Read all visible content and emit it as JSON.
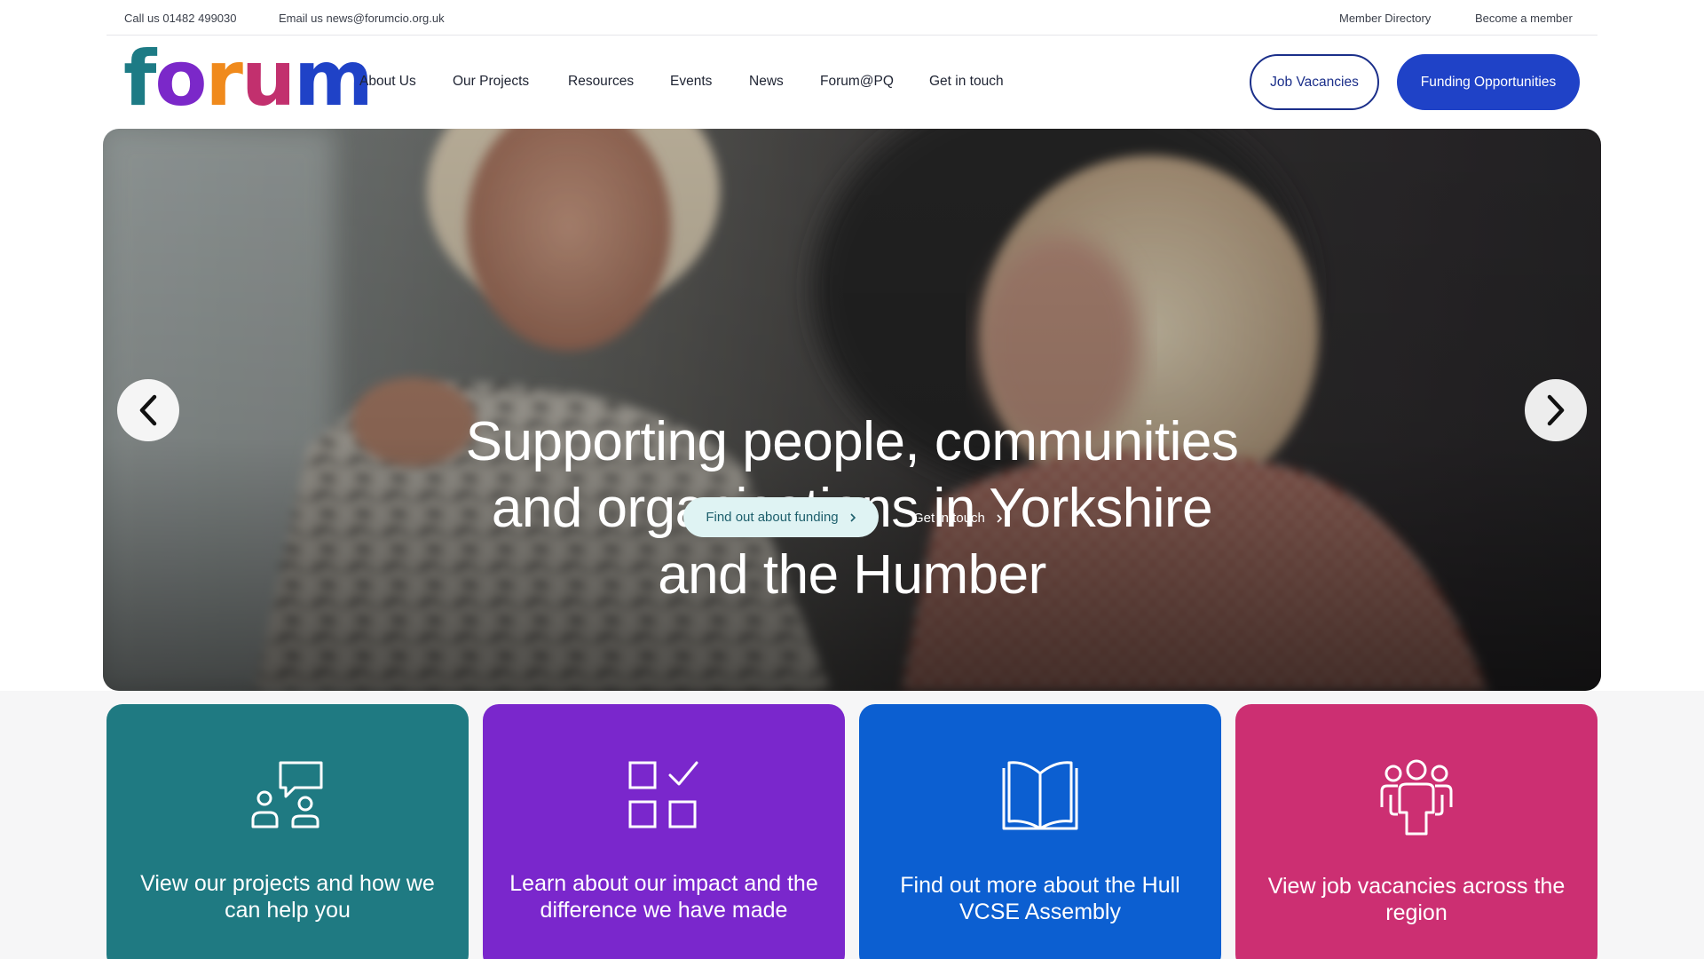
{
  "topbar": {
    "phone": "Call us 01482 499030",
    "email": "Email us news@forumcio.org.uk",
    "member_directory": "Member Directory",
    "become_member": "Become a member"
  },
  "logo": {
    "letters": [
      "f",
      "o",
      "r",
      "u",
      "m"
    ],
    "colors": [
      "#1d7b85",
      "#7b28c9",
      "#f08a1c",
      "#c2306e",
      "#1f42c7"
    ]
  },
  "nav": {
    "items": [
      "About Us",
      "Our Projects",
      "Resources",
      "Events",
      "News",
      "Forum@PQ",
      "Get in touch"
    ]
  },
  "header_buttons": {
    "job_vacancies": "Job Vacancies",
    "funding": "Funding Opportunities"
  },
  "hero": {
    "title_lines": [
      "Supporting people, communities",
      "and organisations in Yorkshire",
      "and the Humber"
    ],
    "primary_cta": "Find out about funding",
    "secondary_cta": "Get in touch",
    "prev_icon": "chevron-left-icon",
    "next_icon": "chevron-right-icon"
  },
  "cards": [
    {
      "text": "View our projects and how we can help you",
      "color": "#1f7a82",
      "icon": "people-chat-icon"
    },
    {
      "text": "Learn about our impact and the difference we have made",
      "color": "#7a27cc",
      "icon": "checklist-grid-icon"
    },
    {
      "text": "Find out more about the Hull VCSE Assembly",
      "color": "#0c5fd1",
      "icon": "open-book-icon"
    },
    {
      "text": "View job vacancies across the region",
      "color": "#cc2f72",
      "icon": "group-people-icon"
    }
  ]
}
